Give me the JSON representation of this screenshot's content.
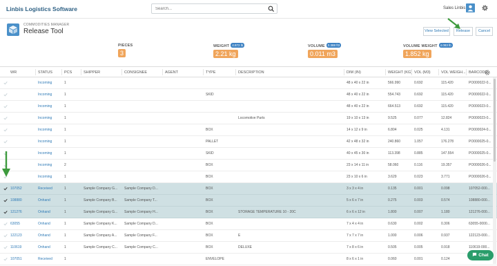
{
  "app": {
    "brand": "Linbis Logistics Software",
    "search_placeholder": "Search...",
    "user": "Sales Linbis"
  },
  "module": {
    "section": "COMMODITIES MANAGER",
    "title": "Release Tool"
  },
  "actions": {
    "view_selected": "View Selected",
    "release": "Release",
    "cancel": "Cancel"
  },
  "stats": {
    "pieces": {
      "label": "PIECES",
      "value": "3"
    },
    "weight": {
      "label": "WEIGHT",
      "pill": "4.872 lb",
      "value": "2.21 kg"
    },
    "volume": {
      "label": "VOLUME",
      "pill": "0.388 ft3",
      "value": "0.011 m3"
    },
    "volume_weight": {
      "label": "VOLUME WEIGHT",
      "pill": "4.083 lb",
      "value": "1.852 kg"
    }
  },
  "columns": [
    "WR",
    "STATUS",
    "PCS",
    "SHIPPER",
    "CONSIGNEE",
    "AGENT",
    "TYPE",
    "DESCRIPTION",
    "DIM (IN)",
    "WEIGHT (KG)",
    "VOL (M3)",
    "VOL WEIGH...",
    "BARCODE"
  ],
  "rows": [
    {
      "wr": "",
      "status": "Incoming",
      "pcs": "1",
      "shipper": "",
      "consignee": "",
      "type": "",
      "desc": "",
      "dim": "48 x 40 x 22 in",
      "weight": "566.990",
      "vol": "0.692",
      "volw": "115.420",
      "barcode": "PO000022-0...",
      "sel": false
    },
    {
      "wr": "",
      "status": "Incoming",
      "pcs": "1",
      "shipper": "",
      "consignee": "",
      "type": "SKID",
      "desc": "",
      "dim": "48 x 40 x 22 in",
      "weight": "554.743",
      "vol": "0.692",
      "volw": "115.420",
      "barcode": "PO000022-0...",
      "sel": false
    },
    {
      "wr": "",
      "status": "Incoming",
      "pcs": "1",
      "shipper": "",
      "consignee": "",
      "type": "",
      "desc": "",
      "dim": "48 x 40 x 22 in",
      "weight": "664.513",
      "vol": "0.692",
      "volw": "115.420",
      "barcode": "PO000023-0...",
      "sel": false
    },
    {
      "wr": "",
      "status": "Incoming",
      "pcs": "1",
      "shipper": "",
      "consignee": "",
      "type": "",
      "desc": "Locomotive Parts",
      "dim": "19 x 10 x 13 in",
      "weight": "9.525",
      "vol": "0.077",
      "volw": "12.824",
      "barcode": "PO000023-0...",
      "sel": false
    },
    {
      "wr": "",
      "status": "Incoming",
      "pcs": "1",
      "shipper": "",
      "consignee": "",
      "type": "BOX",
      "desc": "",
      "dim": "14 x 12 x 9 in",
      "weight": "6.804",
      "vol": "0.025",
      "volw": "4.131",
      "barcode": "PO000024-0...",
      "sel": false
    },
    {
      "wr": "",
      "status": "Incoming",
      "pcs": "1",
      "shipper": "",
      "consignee": "",
      "type": "PALLET",
      "desc": "",
      "dim": "42 x 48 x 32 in",
      "weight": "240.860",
      "vol": "1.057",
      "volw": "176.278",
      "barcode": "PO000025-0...",
      "sel": false
    },
    {
      "wr": "",
      "status": "Incoming",
      "pcs": "1",
      "shipper": "",
      "consignee": "",
      "type": "SKID",
      "desc": "",
      "dim": "40 x 45 x 30 in",
      "weight": "113.398",
      "vol": "0.885",
      "volw": "147.554",
      "barcode": "PO000025-0...",
      "sel": false
    },
    {
      "wr": "",
      "status": "Incoming",
      "pcs": "2",
      "shipper": "",
      "consignee": "",
      "type": "BOX",
      "desc": "",
      "dim": "23 x 14 x 11 in",
      "weight": "58.060",
      "vol": "0.116",
      "volw": "19.357",
      "barcode": "PO000026-0...",
      "sel": false
    },
    {
      "wr": "",
      "status": "Incoming",
      "pcs": "1",
      "shipper": "",
      "consignee": "",
      "type": "BOX",
      "desc": "",
      "dim": "23 x 10 x 6 in",
      "weight": "3.629",
      "vol": "0.023",
      "volw": "3.771",
      "barcode": "PO000026-0...",
      "sel": false
    },
    {
      "wr": "107052",
      "status": "Received",
      "pcs": "1",
      "shipper": "Sample Company G...",
      "consignee": "Sample Company D...",
      "type": "BOX",
      "desc": "",
      "dim": "3 x 3 x 4 in",
      "weight": "0.135",
      "vol": "0.001",
      "volw": "0.098",
      "barcode": "107052-000...",
      "sel": true
    },
    {
      "wr": "108880",
      "status": "Onhand",
      "pcs": "1",
      "shipper": "Sample Company B...",
      "consignee": "Sample Company T...",
      "type": "BOX",
      "desc": "",
      "dim": "5 x 6 x 7 in",
      "weight": "0.275",
      "vol": "0.003",
      "volw": "0.574",
      "barcode": "108880-000...",
      "sel": true
    },
    {
      "wr": "121276",
      "status": "Onhand",
      "pcs": "1",
      "shipper": "Sample Company G...",
      "consignee": "Sample Company H...",
      "type": "BOX",
      "desc": "STORAGE TEMPERATURE 10 - 20C",
      "dim": "6 x 6 x 12 in",
      "weight": "1.800",
      "vol": "0.007",
      "volw": "1.180",
      "barcode": "121276-000...",
      "sel": true
    },
    {
      "wr": "63055",
      "status": "Onhand",
      "pcs": "1",
      "shipper": "Sample Company K...",
      "consignee": "Sample Company D...",
      "type": "BOX",
      "desc": "",
      "dim": "7 x 4 x 4 in",
      "weight": "0.630",
      "vol": "0.002",
      "volw": "0.306",
      "barcode": "63055-0000...",
      "sel": false
    },
    {
      "wr": "122123",
      "status": "Onhand",
      "pcs": "1",
      "shipper": "Sample Company A...",
      "consignee": "Sample Company F...",
      "type": "BOX",
      "desc": "E",
      "dim": "7 x 7 x 7 in",
      "weight": "1.000",
      "vol": "0.006",
      "volw": "0.937",
      "barcode": "122123-000...",
      "sel": false
    },
    {
      "wr": "110619",
      "status": "Onhand",
      "pcs": "1",
      "shipper": "Sample Company C...",
      "consignee": "Sample Company C...",
      "type": "BOX",
      "desc": "DELUXE",
      "dim": "7 x 8 x 6 in",
      "weight": "0.505",
      "vol": "0.005",
      "volw": "0.918",
      "barcode": "110619-000...",
      "sel": false
    },
    {
      "wr": "107051",
      "status": "Received",
      "pcs": "1",
      "shipper": "",
      "consignee": "",
      "type": "ENVELOPE",
      "desc": "",
      "dim": "8 x 6 x 1 in",
      "weight": "0.060",
      "vol": "0.001",
      "volw": "0.124",
      "barcode": "",
      "sel": false
    }
  ],
  "chat": {
    "label": "Chat"
  },
  "colors": {
    "accent": "#2f7ab6",
    "stat": "#f0a55b",
    "selected": "#cfe0e3",
    "arrow": "#3d9a3d"
  }
}
